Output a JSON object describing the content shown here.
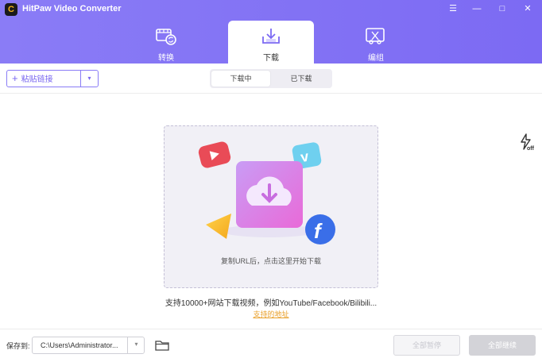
{
  "window": {
    "title": "HitPaw Video Converter",
    "logo_letter": "C",
    "controls": {
      "menu": "☰",
      "minimize": "—",
      "maximize": "□",
      "close": "✕"
    }
  },
  "tabs": [
    {
      "label": "转换",
      "icon": "film-convert-icon"
    },
    {
      "label": "下载",
      "icon": "download-tray-icon",
      "active": true
    },
    {
      "label": "编组",
      "icon": "edit-cut-icon"
    }
  ],
  "toolbar": {
    "paste_plus": "+",
    "paste_label": "粘贴链接",
    "paste_dropdown": "▾",
    "segments": [
      {
        "label": "下载中",
        "active": true
      },
      {
        "label": "已下载",
        "active": false
      }
    ],
    "turbo_label": "off"
  },
  "dropzone": {
    "hint": "复制URL后，点击这里开始下载"
  },
  "info": {
    "supported_text": "支持10000+网站下载视频，例如YouTube/Facebook/Bilibili...",
    "link_text": "支持的地址"
  },
  "bottom": {
    "save_label": "保存到:",
    "save_path": "C:\\Users\\Administrator...",
    "path_dropdown": "▾",
    "pause_all": "全部暂停",
    "resume_all": "全部继续"
  },
  "colors": {
    "accent": "#7c6af3",
    "link": "#e9a02a",
    "header_gradient_start": "#8a7cf6",
    "header_gradient_end": "#7c6af3"
  }
}
